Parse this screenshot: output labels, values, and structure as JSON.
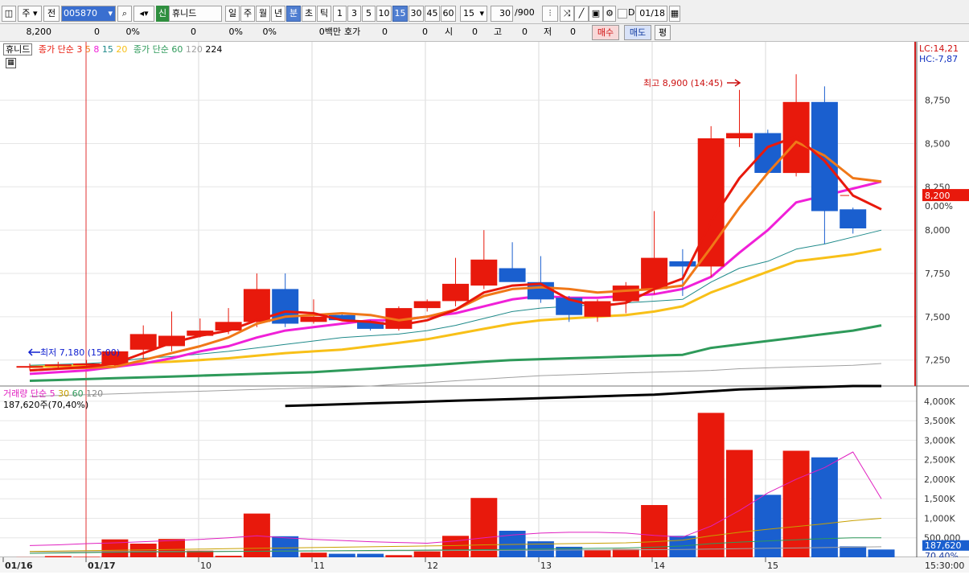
{
  "toolbar": {
    "market_label": "주",
    "all_label": "전",
    "stock_code": "005870",
    "new_badge": "신",
    "stock_name": "휴니드",
    "period_buttons": [
      "일",
      "주",
      "월",
      "년",
      "분",
      "초",
      "틱"
    ],
    "active_period": "분",
    "interval_buttons": [
      "1",
      "3",
      "5",
      "10",
      "15",
      "30",
      "45",
      "60"
    ],
    "active_interval": "15",
    "interval_value": "15",
    "count_value": "30",
    "count_total": "/900",
    "date_value": "01/18"
  },
  "infobar": {
    "price": "8,200",
    "change": "0",
    "change_pct": "0%",
    "volume": "0",
    "vol_pct": "0%",
    "pct3": "0%",
    "amount": "0백만",
    "hoga_label": "호가",
    "hoga1": "0",
    "hoga2": "0",
    "open_label": "시",
    "open_val": "0",
    "high_label": "고",
    "high_val": "0",
    "low_label": "저",
    "low_val": "0",
    "buy_label": "매수",
    "sell_label": "매도",
    "eval_label": "평"
  },
  "price_legend": {
    "name": "휴니드",
    "ma_short_label": "종가 단순",
    "ma_short_periods": [
      "3",
      "5",
      "8",
      "15",
      "20"
    ],
    "ma_long_label": "종가 단순",
    "ma_long_periods": [
      "60",
      "120",
      "224"
    ]
  },
  "price_axis": {
    "ticks": [
      "8,750",
      "8,500",
      "8,250",
      "8,000",
      "7,750",
      "7,500",
      "7,250"
    ],
    "lc_label": "LC:14,21",
    "hc_label": "HC:-7,87",
    "current_tag": "8,200",
    "current_pct": "0,00%"
  },
  "annotations": {
    "high_text": "최고 8,900 (14:45)",
    "low_text": "최저 7,180 (15:00)"
  },
  "volume_legend": {
    "name": "거래량",
    "ma_label": "단순",
    "periods": [
      "5",
      "30",
      "60",
      "120"
    ],
    "current_text": "187,620주(70,40%)"
  },
  "volume_axis": {
    "ticks": [
      "4,000K",
      "3,500K",
      "3,000K",
      "2,500K",
      "2,000K",
      "1,500K",
      "1,000K",
      "500,000"
    ],
    "current_tag": "187,620",
    "current_pct": "70,40%"
  },
  "time_axis": {
    "labels": [
      "01/16",
      "01/17",
      "10",
      "11",
      "12",
      "13",
      "14",
      "15"
    ],
    "right_label": "15:30:00"
  },
  "colors": {
    "up": "#e8190c",
    "down": "#1a5fcf",
    "ma3": "#e8190c",
    "ma5": "#f07818",
    "ma8": "#f020d8",
    "ma15": "#1f8a8a",
    "ma20": "#f8c018",
    "ma60": "#2e9a5a",
    "ma120": "#a0a0a0",
    "ma224": "#000000"
  },
  "chart_data": {
    "type": "candlestick",
    "interval": "15min",
    "candles": [
      {
        "o": 7210,
        "h": 7230,
        "l": 7190,
        "c": 7215
      },
      {
        "o": 7215,
        "h": 7240,
        "l": 7200,
        "c": 7225
      },
      {
        "o": 7220,
        "h": 7250,
        "l": 7200,
        "c": 7230
      },
      {
        "o": 7220,
        "h": 7310,
        "l": 7210,
        "c": 7300
      },
      {
        "o": 7310,
        "h": 7450,
        "l": 7250,
        "c": 7400
      },
      {
        "o": 7330,
        "h": 7530,
        "l": 7300,
        "c": 7390
      },
      {
        "o": 7390,
        "h": 7490,
        "l": 7380,
        "c": 7420
      },
      {
        "o": 7420,
        "h": 7550,
        "l": 7400,
        "c": 7470
      },
      {
        "o": 7470,
        "h": 7750,
        "l": 7440,
        "c": 7660
      },
      {
        "o": 7660,
        "h": 7750,
        "l": 7440,
        "c": 7460
      },
      {
        "o": 7470,
        "h": 7600,
        "l": 7460,
        "c": 7500
      },
      {
        "o": 7510,
        "h": 7520,
        "l": 7480,
        "c": 7480
      },
      {
        "o": 7470,
        "h": 7480,
        "l": 7420,
        "c": 7430
      },
      {
        "o": 7430,
        "h": 7560,
        "l": 7420,
        "c": 7550
      },
      {
        "o": 7550,
        "h": 7600,
        "l": 7530,
        "c": 7590
      },
      {
        "o": 7590,
        "h": 7840,
        "l": 7560,
        "c": 7690
      },
      {
        "o": 7680,
        "h": 8000,
        "l": 7660,
        "c": 7830
      },
      {
        "o": 7780,
        "h": 7930,
        "l": 7720,
        "c": 7700
      },
      {
        "o": 7700,
        "h": 7850,
        "l": 7580,
        "c": 7600
      },
      {
        "o": 7610,
        "h": 7620,
        "l": 7470,
        "c": 7510
      },
      {
        "o": 7500,
        "h": 7600,
        "l": 7470,
        "c": 7590
      },
      {
        "o": 7590,
        "h": 7700,
        "l": 7520,
        "c": 7680
      },
      {
        "o": 7660,
        "h": 8110,
        "l": 7630,
        "c": 7840
      },
      {
        "o": 7820,
        "h": 7890,
        "l": 7620,
        "c": 7790
      },
      {
        "o": 7790,
        "h": 8600,
        "l": 7730,
        "c": 8530
      },
      {
        "o": 8530,
        "h": 8810,
        "l": 8480,
        "c": 8560
      },
      {
        "o": 8560,
        "h": 8580,
        "l": 8360,
        "c": 8330
      },
      {
        "o": 8330,
        "h": 8900,
        "l": 8310,
        "c": 8740
      },
      {
        "o": 8740,
        "h": 8830,
        "l": 7920,
        "c": 8110
      },
      {
        "o": 8120,
        "h": 8130,
        "l": 7980,
        "c": 8010
      }
    ],
    "volume": [
      5,
      30,
      15,
      460,
      350,
      470,
      170,
      40,
      1120,
      540,
      120,
      90,
      90,
      55,
      150,
      550,
      1520,
      680,
      410,
      270,
      180,
      210,
      1340,
      550,
      3700,
      2750,
      1600,
      2730,
      2560,
      280,
      200
    ],
    "ma": {
      "ma3": [
        7190,
        7200,
        7210,
        7230,
        7290,
        7350,
        7390,
        7420,
        7480,
        7530,
        7520,
        7480,
        7470,
        7450,
        7480,
        7540,
        7640,
        7680,
        7690,
        7600,
        7560,
        7580,
        7660,
        7720,
        8050,
        8300,
        8480,
        8540,
        8400,
        8200,
        8120
      ],
      "ma5": [
        7190,
        7200,
        7205,
        7210,
        7250,
        7290,
        7330,
        7380,
        7460,
        7500,
        7510,
        7520,
        7510,
        7480,
        7500,
        7540,
        7620,
        7660,
        7670,
        7660,
        7640,
        7650,
        7660,
        7680,
        7900,
        8130,
        8330,
        8510,
        8430,
        8300,
        8280
      ],
      "ma8": [
        7170,
        7180,
        7190,
        7210,
        7230,
        7260,
        7300,
        7330,
        7380,
        7420,
        7440,
        7460,
        7480,
        7480,
        7500,
        7520,
        7560,
        7600,
        7620,
        7610,
        7610,
        7620,
        7630,
        7660,
        7730,
        7870,
        8000,
        8160,
        8200,
        8240,
        8280
      ],
      "ma15": [
        7220,
        7225,
        7230,
        7240,
        7260,
        7270,
        7285,
        7300,
        7320,
        7340,
        7360,
        7380,
        7390,
        7400,
        7420,
        7450,
        7490,
        7530,
        7550,
        7560,
        7570,
        7580,
        7590,
        7600,
        7700,
        7780,
        7820,
        7890,
        7920,
        7960,
        8000
      ],
      "ma20": [
        7210,
        7215,
        7220,
        7225,
        7235,
        7240,
        7250,
        7260,
        7275,
        7290,
        7300,
        7310,
        7330,
        7350,
        7370,
        7400,
        7430,
        7460,
        7480,
        7490,
        7500,
        7510,
        7530,
        7560,
        7640,
        7700,
        7760,
        7820,
        7840,
        7860,
        7890
      ],
      "ma60": [
        7130,
        7135,
        7140,
        7145,
        7150,
        7155,
        7160,
        7165,
        7170,
        7175,
        7180,
        7190,
        7200,
        7210,
        7220,
        7230,
        7240,
        7250,
        7255,
        7260,
        7265,
        7270,
        7275,
        7280,
        7320,
        7340,
        7360,
        7380,
        7400,
        7420,
        7450
      ],
      "ma120": [
        7040,
        7045,
        7050,
        7055,
        7060,
        7065,
        7070,
        7075,
        7080,
        7085,
        7090,
        7095,
        7100,
        7110,
        7120,
        7130,
        7140,
        7150,
        7160,
        7165,
        7170,
        7175,
        7180,
        7185,
        7190,
        7200,
        7205,
        7210,
        7215,
        7220,
        7230
      ],
      "ma224": [
        null,
        null,
        null,
        null,
        null,
        null,
        null,
        null,
        null,
        6985,
        6990,
        6995,
        7000,
        7005,
        7010,
        7015,
        7020,
        7025,
        7030,
        7035,
        7040,
        7045,
        7050,
        7060,
        7070,
        7080,
        7085,
        7090,
        7095,
        7100,
        7100
      ],
      "vma5": [
        300,
        320,
        350,
        370,
        400,
        430,
        460,
        500,
        550,
        500,
        460,
        430,
        400,
        380,
        360,
        420,
        500,
        570,
        620,
        640,
        640,
        620,
        560,
        520,
        800,
        1200,
        1650,
        2000,
        2300,
        2700,
        1500
      ],
      "vma30": [
        150,
        160,
        170,
        180,
        190,
        200,
        210,
        220,
        230,
        240,
        250,
        260,
        270,
        280,
        290,
        300,
        320,
        330,
        340,
        350,
        360,
        370,
        400,
        440,
        550,
        640,
        720,
        790,
        860,
        940,
        1000
      ],
      "vma60": [
        100,
        110,
        120,
        130,
        135,
        140,
        145,
        150,
        155,
        160,
        165,
        170,
        175,
        180,
        185,
        190,
        195,
        200,
        210,
        220,
        230,
        240,
        260,
        290,
        350,
        390,
        420,
        450,
        480,
        500,
        500
      ],
      "vma120": [
        140,
        140,
        145,
        145,
        150,
        150,
        150,
        155,
        155,
        160,
        160,
        165,
        165,
        170,
        170,
        175,
        175,
        180,
        180,
        185,
        190,
        190,
        195,
        200,
        210,
        220,
        230,
        240,
        250,
        260,
        270
      ]
    },
    "price_ylim": [
      7100,
      9050
    ],
    "volume_ylim": [
      0,
      4100
    ]
  }
}
